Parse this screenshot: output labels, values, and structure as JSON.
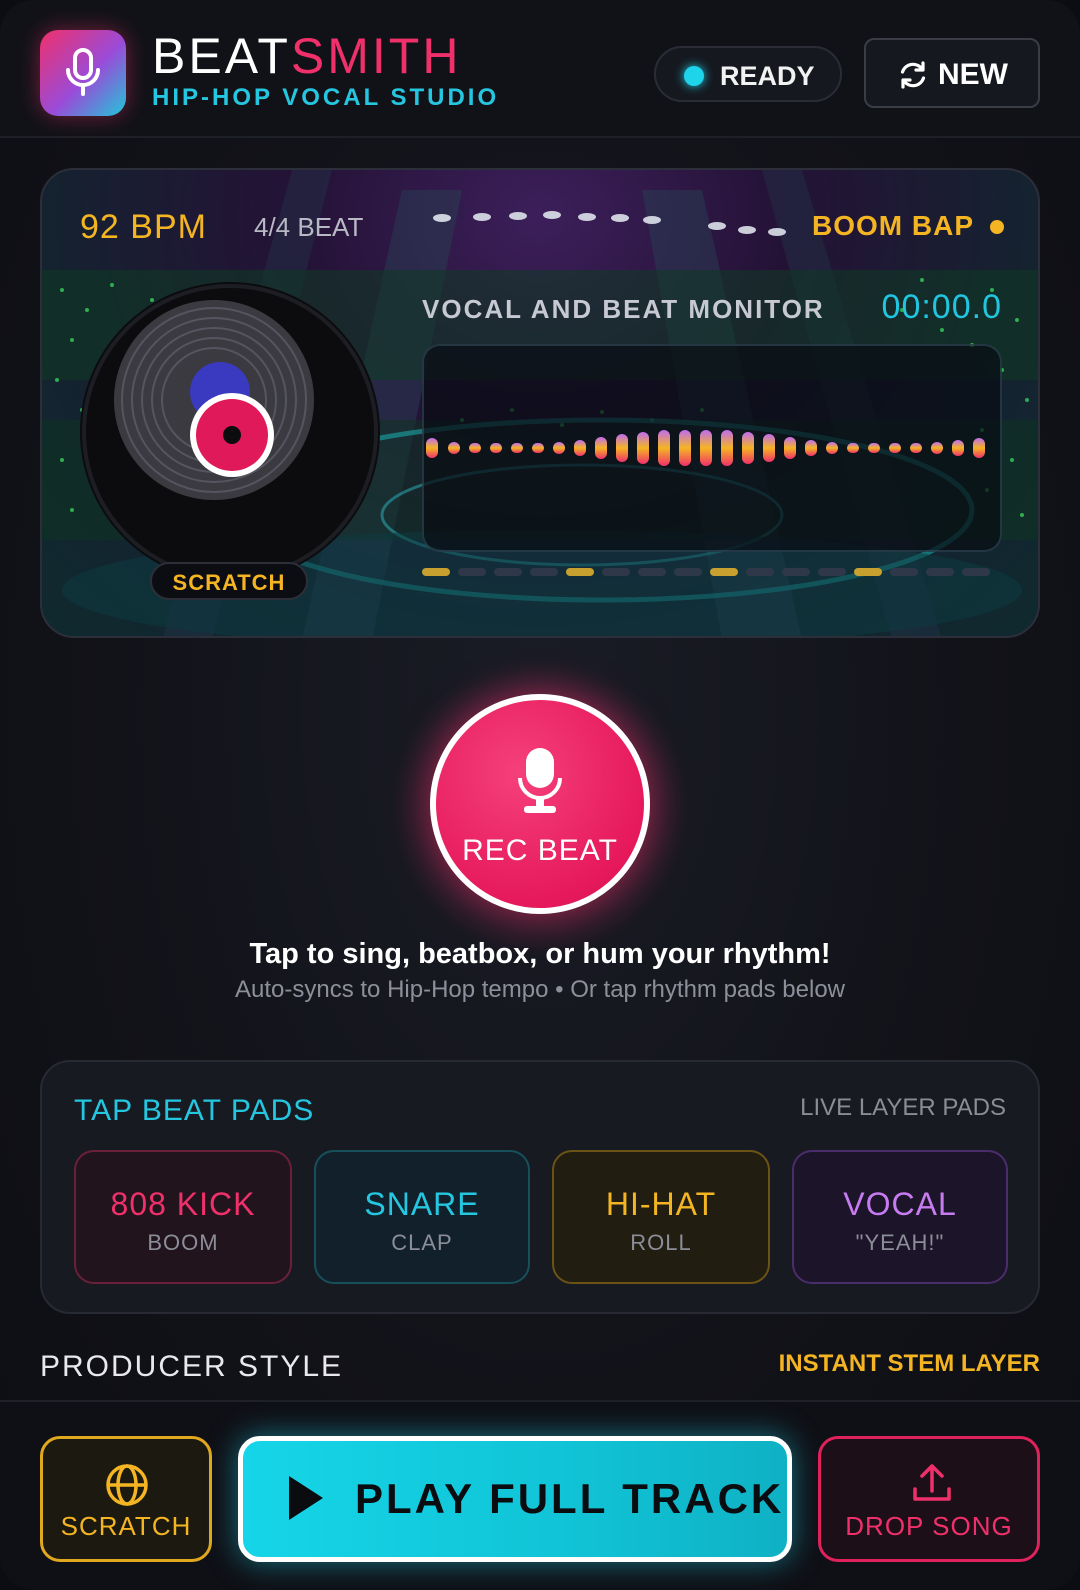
{
  "header": {
    "brand_part1": "BEAT",
    "brand_part2": "SMITH",
    "tagline": "HIP-HOP VOCAL STUDIO",
    "status": "READY",
    "new_label": "NEW"
  },
  "stage": {
    "bpm": "92 BPM",
    "time_signature": "4/4 BEAT",
    "style": "BOOM BAP",
    "monitor_label": "VOCAL AND BEAT MONITOR",
    "timer": "00:00.0",
    "scratch_chip": "SCRATCH"
  },
  "record": {
    "label": "REC BEAT",
    "hint": "Tap to sing, beatbox, or hum your rhythm!",
    "subhint": "Auto-syncs to Hip-Hop tempo • Or tap rhythm pads below"
  },
  "pads": {
    "title": "TAP BEAT PADS",
    "subtitle": "LIVE LAYER PADS",
    "items": [
      {
        "label": "808 KICK",
        "sub": "BOOM"
      },
      {
        "label": "SNARE",
        "sub": "CLAP"
      },
      {
        "label": "HI-HAT",
        "sub": "ROLL"
      },
      {
        "label": "VOCAL",
        "sub": "\"YEAH!\""
      }
    ]
  },
  "producer": {
    "label": "PRODUCER STYLE",
    "stem_label": "INSTANT STEM LAYER"
  },
  "bottom": {
    "scratch_label": "SCRATCH",
    "play_label": "PLAY FULL TRACK",
    "drop_label": "DROP SONG"
  },
  "colors": {
    "accent_pink": "#f0306a",
    "accent_cyan": "#25c6df",
    "accent_gold": "#f5b523",
    "accent_purple": "#c67cf0"
  },
  "icons": {
    "logo": "microphone-icon",
    "new": "refresh-icon",
    "record": "microphone-icon",
    "scratch": "globe-icon",
    "play": "play-icon",
    "drop": "upload-icon"
  }
}
